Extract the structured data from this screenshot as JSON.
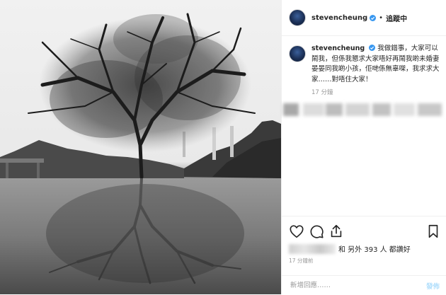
{
  "post": {
    "username": "stevencheung",
    "verified_badge_color": "#3897f0",
    "follow_status": "追蹤中",
    "caption": "我做錯事，大家可以鬧我，但係我懇求大家唔好再鬧我啲未婚妻晏晏同我啲小孩，佢哋係無辜㗎，我求求大家……對唔住大家！",
    "caption_time": "17 分鐘",
    "likes_suffix": "和 另外 393 人 都讚好",
    "post_time": "17 分鐘前",
    "comment_placeholder": "新增回應……",
    "publish_label": "發佈",
    "photo_icons": [
      "tree",
      "reflection",
      "chimney"
    ],
    "action_icons": [
      "heart-icon",
      "comment-icon",
      "share-icon",
      "bookmark-icon"
    ]
  }
}
